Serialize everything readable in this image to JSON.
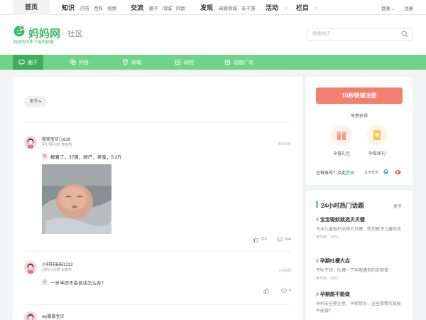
{
  "topnav": {
    "home": "首页",
    "groups": [
      {
        "main": "知识",
        "subs": [
          "问答",
          "百科",
          "视频"
        ]
      },
      {
        "main": "交流",
        "subs": [
          "圈子",
          "同城",
          "同龄"
        ]
      },
      {
        "main": "发现",
        "subs": [
          "母婴商城",
          "亲子游"
        ]
      }
    ],
    "activity": "活动",
    "column": "栏目",
    "login": "登录",
    "register": "注册"
  },
  "header": {
    "logo_text": "妈妈网",
    "community": "· 社区",
    "slogan": "妈妈的世界  只有妈妈懂",
    "search_placeholder": "搜索帖子"
  },
  "tabs": [
    {
      "label": "圈子",
      "icon": "chat-bubble-icon",
      "active": true
    },
    {
      "label": "问答",
      "icon": "qa-icon",
      "active": false
    },
    {
      "label": "同城",
      "icon": "location-pin-icon",
      "active": false
    },
    {
      "label": "同院",
      "icon": "hospital-icon",
      "active": false
    },
    {
      "label": "话题广场",
      "icon": "topic-icon",
      "active": false
    }
  ],
  "feed": {
    "more_label": "更多 ▸",
    "posts": [
      {
        "author": "莞莞宝贝儿819",
        "meta": "孕17周+0天   莞莞市",
        "date": "4月03日",
        "badge": "晒",
        "text": "报喜了，37周，顺产，男宝，5.2斤",
        "likes": "726",
        "comments": "504"
      },
      {
        "author": "小轩轩麻麻1213",
        "meta": "1岁5个月卿   东莞市",
        "date": "3小时前",
        "badge": "问",
        "text": "一岁半还不会说话怎么办？",
        "likes": "",
        "comments": "0"
      },
      {
        "author": "wy震震宝贝"
      }
    ]
  },
  "sidebar": {
    "register_btn": "10秒快速注册",
    "free_label": "免费获得",
    "gift1": "孕育礼包",
    "gift2": "孕育周刊",
    "login_prompt": "已有账号？点此",
    "login_link": "登录",
    "other_login": "其他登录",
    "hot_title": "24小时热门话题",
    "hot_more": "更多",
    "topics": [
      {
        "title": "宝宝驱蚊就选贝贝健",
        "desc": "专业儿童驱护品牌贝贝健，帮您解决儿童蚊扰",
        "count": "参与数：1979"
      },
      {
        "title": "孕期吐槽大会",
        "desc": "不吐不快，吐槽一下孕期遇到的奇葩事",
        "count": "参与数：9925"
      },
      {
        "title": "孕期能不能做",
        "desc": "孕妈安全需注意，孕期禁忌，这些事情究竟能不能做？",
        "count": ""
      }
    ]
  },
  "colors": {
    "green": "#6fd38a",
    "green_dark": "#3fae5c",
    "coral": "#f57f6e"
  }
}
